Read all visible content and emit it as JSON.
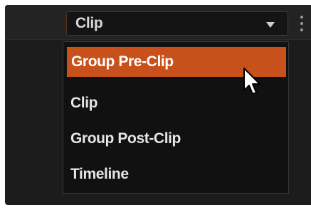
{
  "clip_select": {
    "value": "Clip"
  },
  "dropdown": {
    "items": [
      {
        "label": "Group Pre-Clip",
        "selected": true
      },
      {
        "label": "Clip",
        "selected": false
      },
      {
        "label": "Group Post-Clip",
        "selected": false
      },
      {
        "label": "Timeline",
        "selected": false
      }
    ]
  },
  "colors": {
    "accent": "#c8501a",
    "panel": "#1c1c1c",
    "menu_bg": "#111111",
    "text": "#e6e6e6"
  },
  "icons": {
    "dropdown_caret": "chevron-down-icon",
    "more_options": "more-vertical-icon",
    "cursor": "mouse-pointer-icon"
  }
}
